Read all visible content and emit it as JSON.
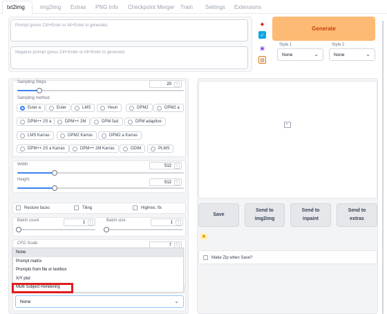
{
  "tabs": [
    {
      "label": "txt2img",
      "active": true
    },
    {
      "label": "img2img"
    },
    {
      "label": "Extras"
    },
    {
      "label": "PNG Info"
    },
    {
      "label": "Checkpoint Merger"
    },
    {
      "label": "Train"
    },
    {
      "label": "Settings"
    },
    {
      "label": "Extensions"
    }
  ],
  "prompt": {
    "placeholder": "Prompt (press Ctrl+Enter or Alt+Enter to generate)"
  },
  "negative_prompt": {
    "placeholder": "Negative prompt (press Ctrl+Enter or Alt+Enter to generate)"
  },
  "generate_label": "Generate",
  "styles": {
    "style1_label": "Style 1",
    "style1_value": "None",
    "style2_label": "Style 2",
    "style2_value": "None"
  },
  "sampling": {
    "steps_label": "Sampling Steps",
    "steps_value": "20",
    "method_label": "Sampling method",
    "methods": [
      "Euler a",
      "Euler",
      "LMS",
      "Heun",
      "DPM2",
      "DPM2 a",
      "DPM++ 2S a",
      "DPM++ 2M",
      "DPM fast",
      "DPM adaptive",
      "LMS Karras",
      "DPM2 Karras",
      "DPM2 a Karras",
      "DPM++ 2S a Karras",
      "DPM++ 2M Karras",
      "DDIM",
      "PLMS"
    ],
    "selected": "Euler a"
  },
  "size": {
    "width_label": "Width",
    "width_value": "512",
    "height_label": "Height",
    "height_value": "512"
  },
  "options": {
    "restore_faces": "Restore faces",
    "tiling": "Tiling",
    "highres_fix": "Highres. fix"
  },
  "batch": {
    "count_label": "Batch count",
    "count_value": "1",
    "size_label": "Batch size",
    "size_value": "1"
  },
  "cfg": {
    "label": "CFG Scale",
    "value": "7"
  },
  "script_dropdown": {
    "options": [
      "None",
      "Prompt matrix",
      "Prompts from file or textbox",
      "X/Y plot",
      "Multi Subject Rendering"
    ],
    "highlighted": "Multi Subject Rendering",
    "value": "None"
  },
  "actions": {
    "save": "Save",
    "send_img2img": "Send to img2img",
    "send_inpaint": "Send to inpaint",
    "send_extras": "Send to extras"
  },
  "make_zip_label": "Make Zip when Save?",
  "colors": {
    "accent": "#3b82f6",
    "generate_bg": "#fdba74",
    "generate_text": "#c2410c",
    "highlight_border": "#e11d1d"
  }
}
